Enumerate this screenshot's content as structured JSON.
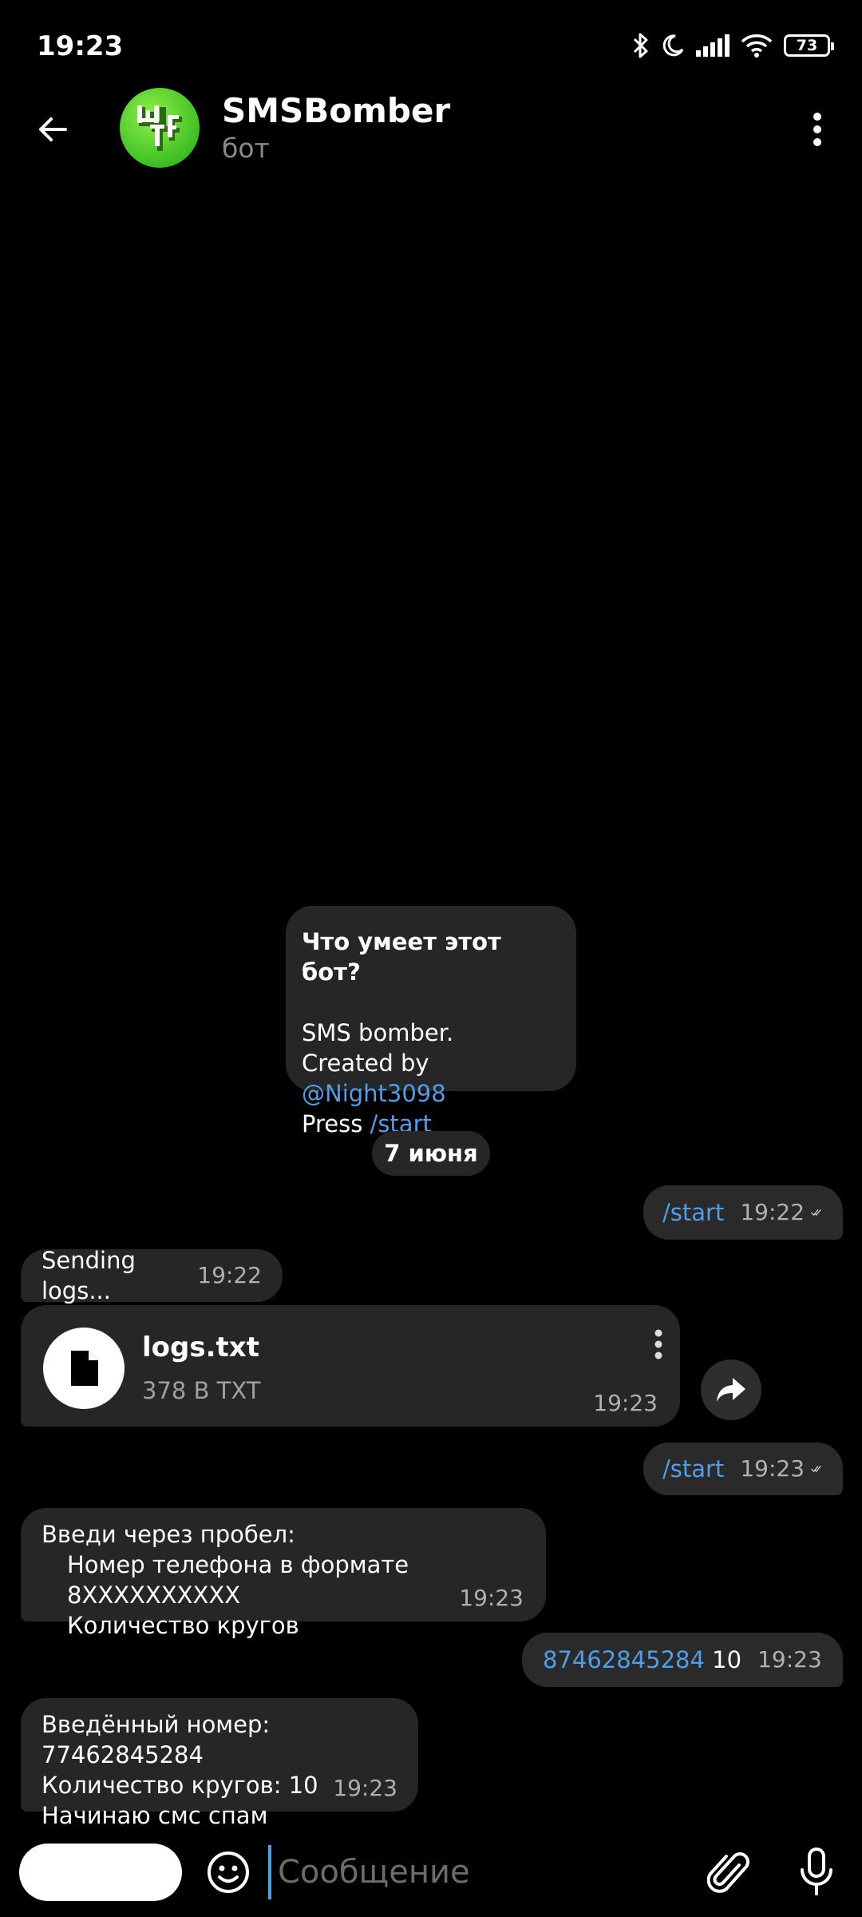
{
  "status_bar": {
    "time": "19:23",
    "battery": "73"
  },
  "header": {
    "title": "SMSBomber",
    "subtitle": "бот"
  },
  "bot_info": {
    "title": "Что умеет этот бот?",
    "line1": "SMS bomber.",
    "line2_prefix": "Created by ",
    "line2_link": "@Night3098",
    "line3_prefix": "Press ",
    "line3_link": "/start"
  },
  "date_separator": "7 июня",
  "messages": [
    {
      "direction": "out",
      "command": "/start",
      "time": "19:22"
    },
    {
      "direction": "in",
      "text": "Sending logs...",
      "time": "19:22"
    },
    {
      "direction": "in",
      "file_name": "logs.txt",
      "file_meta": "378 B TXT",
      "time": "19:23"
    },
    {
      "direction": "out",
      "command": "/start",
      "time": "19:23"
    },
    {
      "direction": "in",
      "line1": "Введи через пробел:",
      "line2": "Номер телефона в формате 8XXXXXXXXXX",
      "line3": "Количество кругов",
      "time": "19:23"
    },
    {
      "direction": "out",
      "link": "87462845284",
      "text": " 10",
      "time": "19:23"
    },
    {
      "direction": "in",
      "line1": "Введённый номер: 77462845284",
      "line2": "Количество кругов: 10",
      "line3": "Начинаю смс спам",
      "time": "19:23"
    }
  ],
  "composer": {
    "placeholder": "Сообщение"
  },
  "colors": {
    "background": "#000000",
    "bubble": "#262626",
    "link": "#4f9ee8",
    "avatar": "#4fcf2a"
  }
}
